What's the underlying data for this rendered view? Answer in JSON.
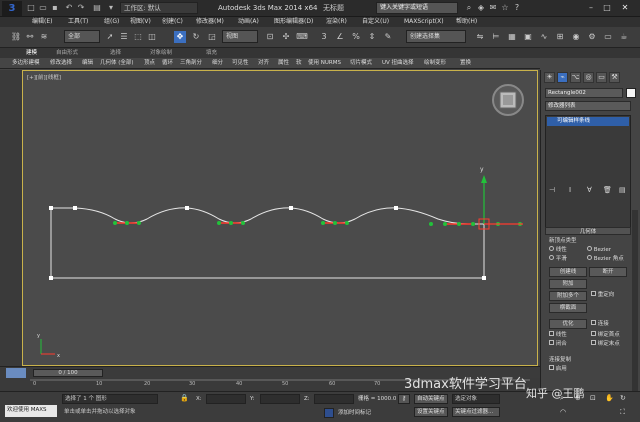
{
  "titlebar": {
    "workspace": "工作区: 默认",
    "app_title": "Autodesk 3ds Max  2014 x64",
    "doc_title": "无标题",
    "search_placeholder": "键入关键字或短语"
  },
  "menu": [
    "编辑(E)",
    "工具(T)",
    "组(G)",
    "视图(V)",
    "创建(C)",
    "修改器(M)",
    "动画(A)",
    "图形编辑器(D)",
    "渲染(R)",
    "自定义(U)",
    "MAXScript(X)",
    "帮助(H)"
  ],
  "toolbar": {
    "selection_filter": "全部",
    "ref_coord": "视图",
    "named_selection": "创建选择集"
  },
  "ribbon_tabs": [
    "建模",
    "自由形式",
    "选择",
    "对象绘制",
    "填充"
  ],
  "ribbon_buttons": [
    "多边形建模",
    "修改选择",
    "编辑",
    "几何体 (全部)",
    "顶点",
    "循环",
    "三角剖分",
    "细分",
    "可见性",
    "对齐",
    "属性",
    "软",
    "使用 NURMS",
    "切片模式",
    "UV 扭曲选择",
    "绘制变形",
    "置换"
  ],
  "viewport": {
    "label": "[+][前][线框]",
    "axis_x": "x",
    "axis_y": "y"
  },
  "command_panel": {
    "object_name": "Rectangle002",
    "modifier_list": "修改器列表",
    "stack_item": "可编辑样条线",
    "rollout_geometry": "几何体",
    "new_vertex_type": "新顶点类型",
    "linear": "线性",
    "bezier": "Bezier",
    "smooth": "平滑",
    "bezier_corner": "Bezier 角点",
    "create_line": "创建线",
    "break": "断开",
    "attach": "附加",
    "attach_multiple": "附加多个",
    "reorient": "重定向",
    "cross_section": "横截面",
    "refine": "优化",
    "connect": "连接",
    "linear_chk": "线性",
    "bind_first": "绑定首点",
    "closed": "闭合",
    "bind_last": "绑定末点",
    "connect_copy": "连接复制",
    "enable": "启用"
  },
  "timeline": {
    "frame": "0 / 100",
    "ticks": [
      "0",
      "10",
      "20",
      "30",
      "40",
      "50",
      "60",
      "70"
    ]
  },
  "statusbar": {
    "welcome": "欢迎使用 MAXS",
    "selected": "选择了 1 个 图形",
    "prompt": "单击或单击并拖动以选择对象",
    "x_label": "X:",
    "y_label": "Y:",
    "z_label": "Z:",
    "grid": "栅格 = 1000.0",
    "autokey": "自动关键点",
    "selected_obj": "选定对象",
    "set_key": "设置关键点",
    "key_filter": "关键点过滤器...",
    "add_time_tag": "添加时间标记"
  },
  "watermark": {
    "text": "3dmax软件学习平台",
    "zhihu": "知乎 @王鹏"
  },
  "colors": {
    "viewport_bg": "#4b4b4b",
    "viewport_border": "#c9b24b",
    "spline": "#e6e6e6",
    "vertex_green": "#22c23a",
    "segment_red": "#ff3b2e",
    "selection_blue": "#2f5fa8"
  }
}
